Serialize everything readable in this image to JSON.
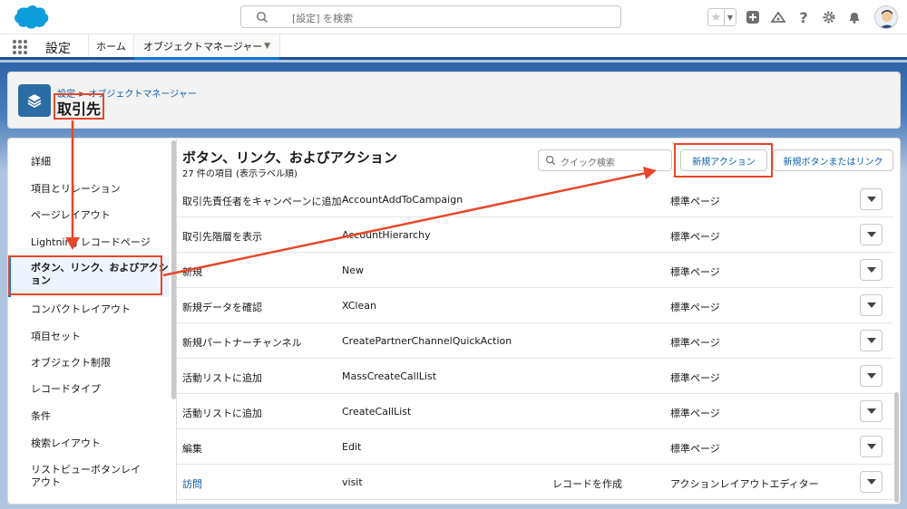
{
  "header": {
    "search_placeholder": "[設定] を検索",
    "icons": [
      "salesforce-cloud-logo",
      "search-icon",
      "star-icon",
      "chevron-down-icon",
      "plus-icon",
      "trailhead-icon",
      "help-icon",
      "gear-icon",
      "bell-icon",
      "avatar"
    ]
  },
  "nav": {
    "app_name": "設定",
    "tabs": [
      "ホーム",
      "オブジェクトマネージャー"
    ]
  },
  "object_header": {
    "breadcrumb": [
      "設定",
      "オブジェクトマネージャー"
    ],
    "breadcrumb_sep": ">",
    "title": "取引先"
  },
  "sidebar": {
    "items": [
      "詳細",
      "項目とリレーション",
      "ページレイアウト",
      "Lightning レコードページ",
      "ボタン、リンク、およびアクション",
      "コンパクトレイアウト",
      "項目セット",
      "オブジェクト制限",
      "レコードタイプ",
      "条件",
      "検索レイアウト",
      "リストビューボタンレイアウト"
    ],
    "active_index": 4
  },
  "main": {
    "title": "ボタン、リンク、およびアクション",
    "subtitle": "27 件の項目 (表示ラベル順)",
    "quick_search_placeholder": "クイック検索",
    "new_action_label": "新規アクション",
    "new_button_label": "新規ボタンまたはリンク",
    "rows": [
      {
        "label": "取引先責任者をキャンペーンに追加",
        "name": "AccountAddToCampaign",
        "type": "",
        "content": "標準ページ"
      },
      {
        "label": "取引先階層を表示",
        "name": "AccountHierarchy",
        "type": "",
        "content": "標準ページ"
      },
      {
        "label": "新規",
        "name": "New",
        "type": "",
        "content": "標準ページ"
      },
      {
        "label": "新規データを確認",
        "name": "XClean",
        "type": "",
        "content": "標準ページ"
      },
      {
        "label": "新規パートナーチャンネル",
        "name": "CreatePartnerChannelQuickAction",
        "type": "",
        "content": "標準ページ"
      },
      {
        "label": "活動リストに追加",
        "name": "MassCreateCallList",
        "type": "",
        "content": "標準ページ"
      },
      {
        "label": "活動リストに追加",
        "name": "CreateCallList",
        "type": "",
        "content": "標準ページ"
      },
      {
        "label": "編集",
        "name": "Edit",
        "type": "",
        "content": "標準ページ"
      },
      {
        "label": "訪問",
        "name": "visit",
        "type": "レコードを作成",
        "content": "アクションレイアウトエディター"
      }
    ]
  },
  "colors": {
    "brand_blue": "#0176d3",
    "link_blue": "#0b5cab",
    "annotation_red": "#e8472a",
    "header_band": "#2e64a8"
  }
}
